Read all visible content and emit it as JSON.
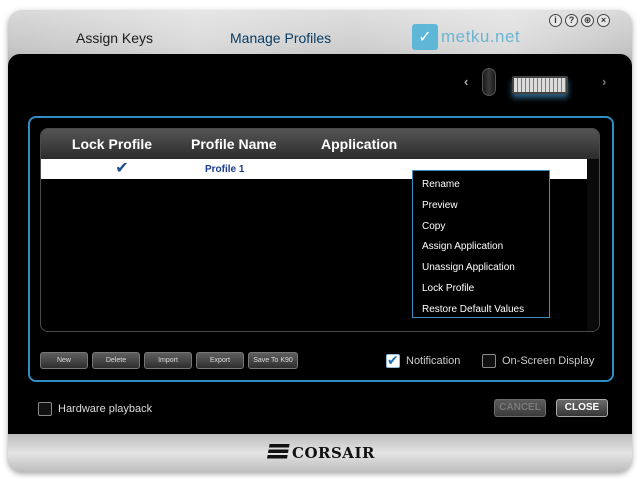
{
  "tabs": {
    "assign_keys": "Assign Keys",
    "manage_profiles": "Manage Profiles"
  },
  "watermark": "metku.net",
  "window_icons": [
    "info-icon",
    "help-icon",
    "globe-icon",
    "close-icon"
  ],
  "table": {
    "headers": {
      "lock": "Lock Profile",
      "name": "Profile Name",
      "application": "Application"
    },
    "rows": [
      {
        "locked": true,
        "name": "Profile 1",
        "application": ""
      }
    ]
  },
  "context_menu": [
    "Rename",
    "Preview",
    "Copy",
    "Assign Application",
    "Unassign Application",
    "Lock Profile",
    "Restore Default Values"
  ],
  "buttons": {
    "new": "New",
    "delete": "Delete",
    "import": "Import",
    "export": "Export",
    "save_to": "Save To K90"
  },
  "options": {
    "notification": {
      "label": "Notification",
      "checked": true
    },
    "osd": {
      "label": "On-Screen Display",
      "checked": false
    }
  },
  "hardware_playback": {
    "label": "Hardware playback",
    "checked": false
  },
  "dialog_buttons": {
    "cancel": "CANCEL",
    "close": "CLOSE"
  },
  "brand": "CORSAIR",
  "colors": {
    "accent": "#2f8fc4",
    "selected_row_text": "#1b3b8f"
  }
}
